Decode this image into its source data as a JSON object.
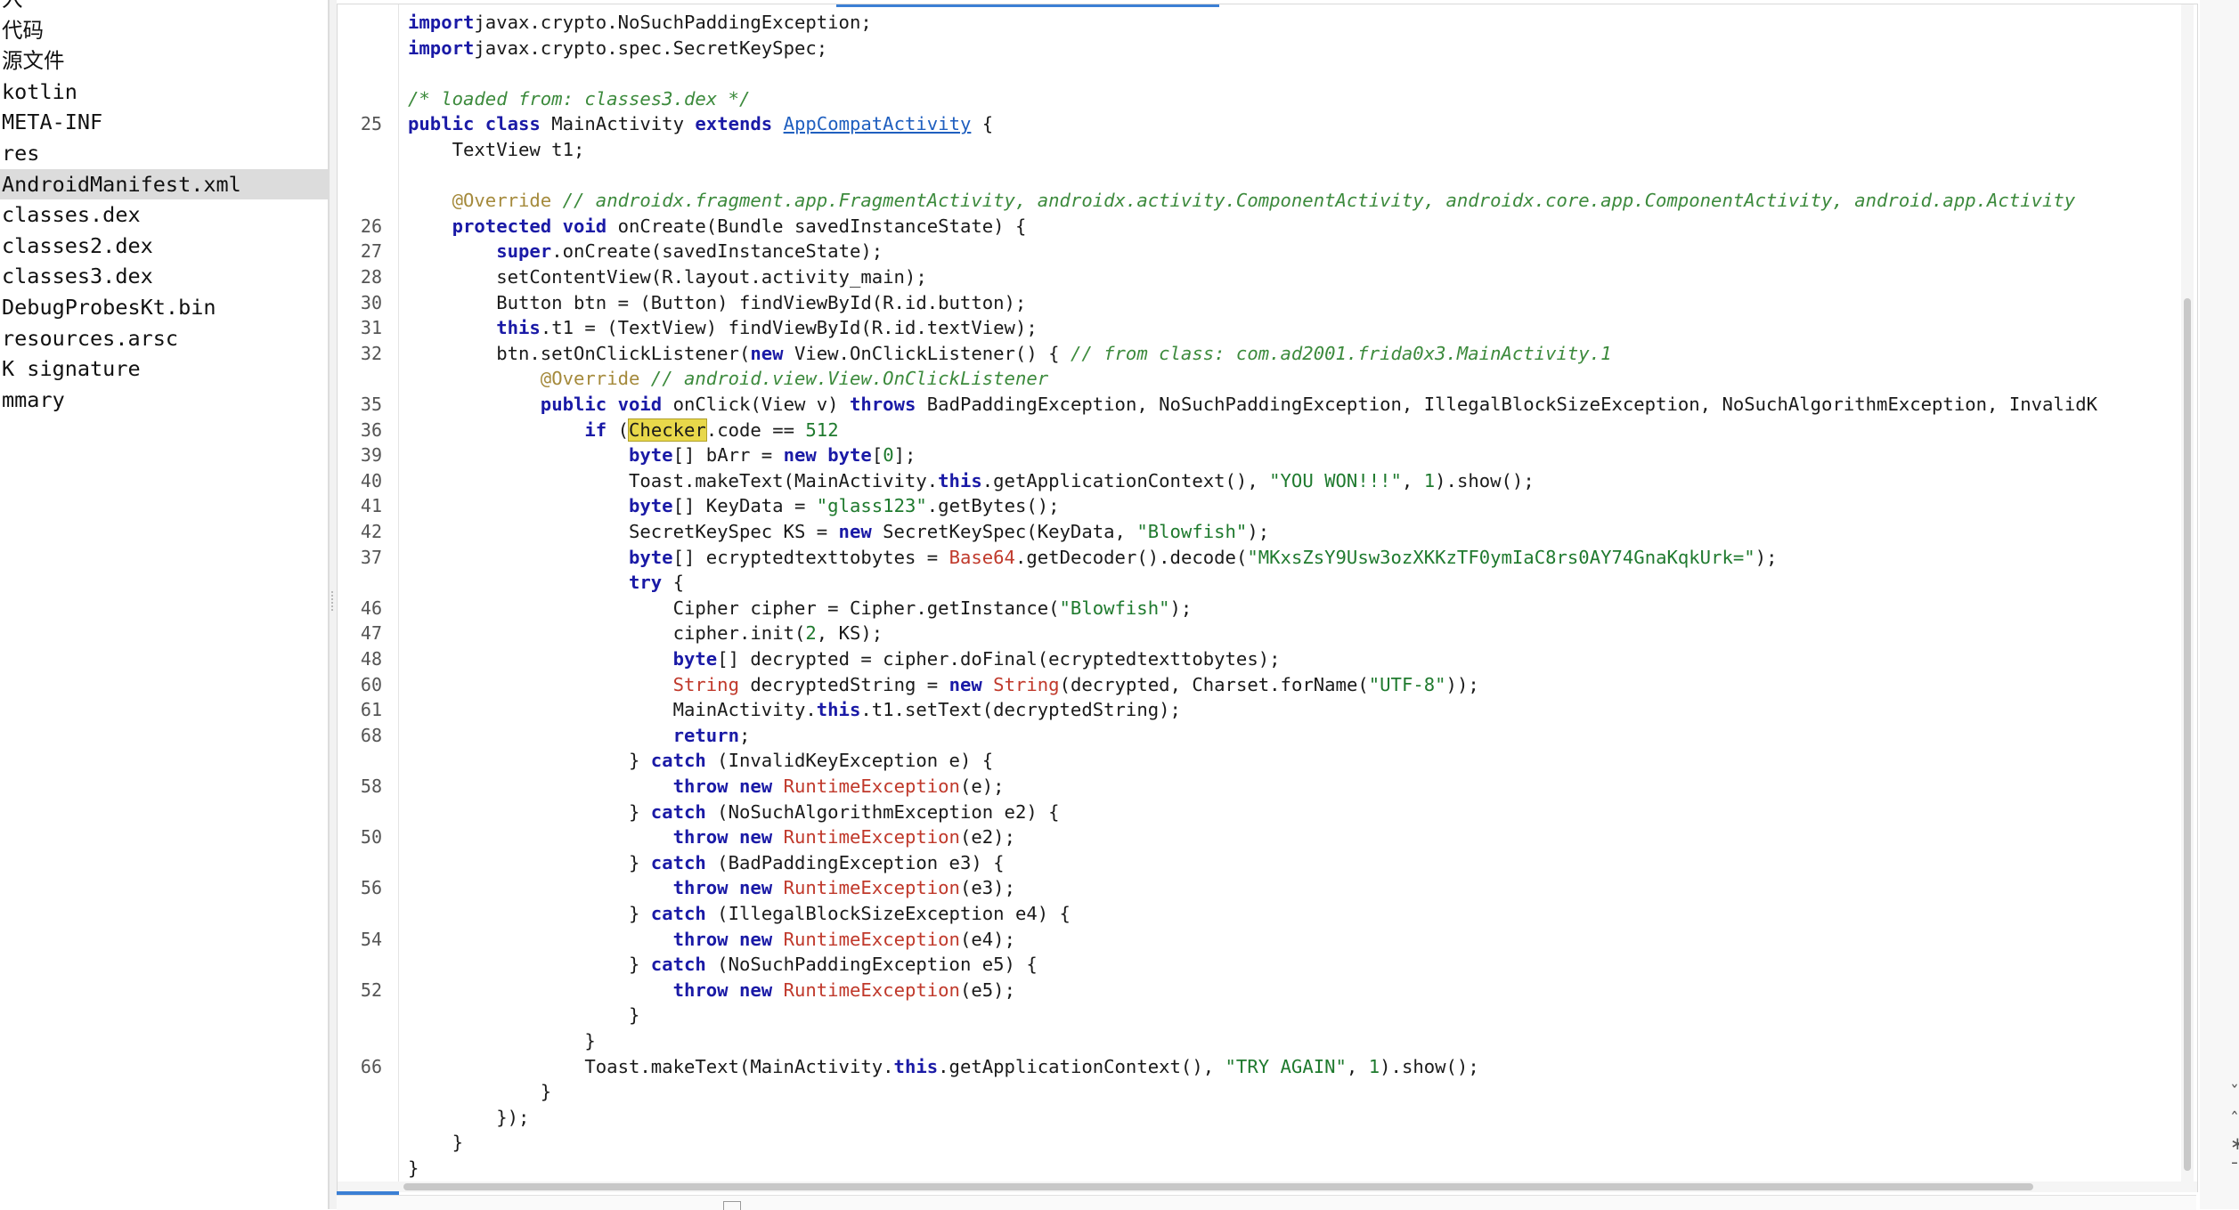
{
  "sidebar": {
    "items": [
      {
        "label": "入",
        "selected": false
      },
      {
        "label": "代码",
        "selected": false
      },
      {
        "label": "源文件",
        "selected": false
      },
      {
        "label": "kotlin",
        "selected": false
      },
      {
        "label": "META-INF",
        "selected": false
      },
      {
        "label": "res",
        "selected": false
      },
      {
        "label": "AndroidManifest.xml",
        "selected": true
      },
      {
        "label": "classes.dex",
        "selected": false
      },
      {
        "label": "classes2.dex",
        "selected": false
      },
      {
        "label": "classes3.dex",
        "selected": false
      },
      {
        "label": "DebugProbesKt.bin",
        "selected": false
      },
      {
        "label": "resources.arsc",
        "selected": false
      },
      {
        "label": "K signature",
        "selected": false
      },
      {
        "label": "mmary",
        "selected": false
      }
    ]
  },
  "editor": {
    "highlight_color": "#e8d84a",
    "lines": [
      {
        "n": "",
        "t": [
          [
            "kw",
            "import"
          ],
          [
            "",
            "javax.crypto.NoSuchPaddingException;"
          ]
        ]
      },
      {
        "n": "",
        "t": [
          [
            "kw",
            "import"
          ],
          [
            "",
            "javax.crypto.spec.SecretKeySpec;"
          ]
        ]
      },
      {
        "n": "",
        "t": []
      },
      {
        "n": "",
        "t": [
          [
            "cm",
            "/* loaded from: classes3.dex */"
          ]
        ]
      },
      {
        "n": "25",
        "t": [
          [
            "kw",
            "public class"
          ],
          [
            "",
            " MainActivity "
          ],
          [
            "kw",
            "extends"
          ],
          [
            "",
            " "
          ],
          [
            "lk",
            "AppCompatActivity"
          ],
          [
            "",
            " {"
          ]
        ]
      },
      {
        "n": "",
        "t": [
          [
            "",
            "    TextView t1;"
          ]
        ]
      },
      {
        "n": "",
        "t": []
      },
      {
        "n": "",
        "t": [
          [
            "",
            "    "
          ],
          [
            "an",
            "@Override"
          ],
          [
            "",
            " "
          ],
          [
            "cm",
            "// androidx.fragment.app.FragmentActivity, androidx.activity.ComponentActivity, androidx.core.app.ComponentActivity, android.app.Activity"
          ]
        ]
      },
      {
        "n": "26",
        "t": [
          [
            "",
            "    "
          ],
          [
            "kw",
            "protected void"
          ],
          [
            "",
            " onCreate(Bundle savedInstanceState) {"
          ]
        ]
      },
      {
        "n": "27",
        "t": [
          [
            "",
            "        "
          ],
          [
            "kw",
            "super"
          ],
          [
            "",
            ".onCreate(savedInstanceState);"
          ]
        ]
      },
      {
        "n": "28",
        "t": [
          [
            "",
            "        setContentView(R.layout.activity_main);"
          ]
        ]
      },
      {
        "n": "30",
        "t": [
          [
            "",
            "        Button btn = (Button) findViewById(R.id.button);"
          ]
        ]
      },
      {
        "n": "31",
        "t": [
          [
            "",
            "        "
          ],
          [
            "kw",
            "this"
          ],
          [
            "",
            ".t1 = (TextView) findViewById(R.id.textView);"
          ]
        ]
      },
      {
        "n": "32",
        "t": [
          [
            "",
            "        btn.setOnClickListener("
          ],
          [
            "kw",
            "new"
          ],
          [
            "",
            " View.OnClickListener() { "
          ],
          [
            "cm",
            "// from class: com.ad2001.frida0x3.MainActivity.1"
          ]
        ]
      },
      {
        "n": "",
        "t": [
          [
            "",
            "            "
          ],
          [
            "an",
            "@Override"
          ],
          [
            "",
            " "
          ],
          [
            "cm",
            "// android.view.View.OnClickListener"
          ]
        ]
      },
      {
        "n": "35",
        "t": [
          [
            "",
            "            "
          ],
          [
            "kw",
            "public void"
          ],
          [
            "",
            " onClick(View v) "
          ],
          [
            "kw",
            "throws"
          ],
          [
            "",
            " BadPaddingException, NoSuchPaddingException, IllegalBlockSizeException, NoSuchAlgorithmException, InvalidK"
          ]
        ]
      },
      {
        "n": "36",
        "t": [
          [
            "",
            "                "
          ],
          [
            "kw",
            "if"
          ],
          [
            "",
            " ("
          ],
          [
            "hl",
            "Checker"
          ],
          [
            "",
            ".code == "
          ],
          [
            "nm",
            "512"
          ],
          [
            ") {"
          ]
        ]
      },
      {
        "n": "39",
        "t": [
          [
            "",
            "                    "
          ],
          [
            "kw",
            "byte"
          ],
          [
            "",
            "[] bArr = "
          ],
          [
            "kw",
            "new"
          ],
          [
            "",
            " "
          ],
          [
            "kw",
            "byte"
          ],
          [
            "",
            "["
          ],
          [
            "nm",
            "0"
          ],
          [
            "",
            "];"
          ]
        ]
      },
      {
        "n": "40",
        "t": [
          [
            "",
            "                    Toast.makeText(MainActivity."
          ],
          [
            "kw",
            "this"
          ],
          [
            "",
            ".getApplicationContext(), "
          ],
          [
            "st",
            "\"YOU WON!!!\""
          ],
          [
            "",
            ", "
          ],
          [
            "nm",
            "1"
          ],
          [
            "",
            ").show();"
          ]
        ]
      },
      {
        "n": "41",
        "t": [
          [
            "",
            "                    "
          ],
          [
            "kw",
            "byte"
          ],
          [
            "",
            "[] KeyData = "
          ],
          [
            "st",
            "\"glass123\""
          ],
          [
            "",
            ".getBytes();"
          ]
        ]
      },
      {
        "n": "42",
        "t": [
          [
            "",
            "                    SecretKeySpec KS = "
          ],
          [
            "kw",
            "new"
          ],
          [
            "",
            " SecretKeySpec(KeyData, "
          ],
          [
            "st",
            "\"Blowfish\""
          ],
          [
            "",
            ");"
          ]
        ]
      },
      {
        "n": "37",
        "t": [
          [
            "",
            "                    "
          ],
          [
            "kw",
            "byte"
          ],
          [
            "",
            "[] ecryptedtexttobytes = "
          ],
          [
            "ty",
            "Base64"
          ],
          [
            "",
            ".getDecoder().decode("
          ],
          [
            "st",
            "\"MKxsZsY9Usw3ozXKKzTF0ymIaC8rs0AY74GnaKqkUrk=\""
          ],
          [
            "",
            ");"
          ]
        ]
      },
      {
        "n": "",
        "t": [
          [
            "",
            "                    "
          ],
          [
            "kw",
            "try"
          ],
          [
            "",
            " {"
          ]
        ]
      },
      {
        "n": "46",
        "t": [
          [
            "",
            "                        Cipher cipher = Cipher.getInstance("
          ],
          [
            "st",
            "\"Blowfish\""
          ],
          [
            "",
            ");"
          ]
        ]
      },
      {
        "n": "47",
        "t": [
          [
            "",
            "                        cipher.init("
          ],
          [
            "nm",
            "2"
          ],
          [
            "",
            ", KS);"
          ]
        ]
      },
      {
        "n": "48",
        "t": [
          [
            "",
            "                        "
          ],
          [
            "kw",
            "byte"
          ],
          [
            "",
            "[] decrypted = cipher.doFinal(ecryptedtexttobytes);"
          ]
        ]
      },
      {
        "n": "60",
        "t": [
          [
            "",
            "                        "
          ],
          [
            "ty",
            "String"
          ],
          [
            "",
            " decryptedString = "
          ],
          [
            "kw",
            "new"
          ],
          [
            "",
            " "
          ],
          [
            "ty",
            "String"
          ],
          [
            "",
            "(decrypted, Charset.forName("
          ],
          [
            "st",
            "\"UTF-8\""
          ],
          [
            "",
            "));"
          ]
        ]
      },
      {
        "n": "61",
        "t": [
          [
            "",
            "                        MainActivity."
          ],
          [
            "kw",
            "this"
          ],
          [
            "",
            ".t1.setText(decryptedString);"
          ]
        ]
      },
      {
        "n": "68",
        "t": [
          [
            "",
            "                        "
          ],
          [
            "kw",
            "return"
          ],
          [
            "",
            ";"
          ]
        ]
      },
      {
        "n": "",
        "t": [
          [
            "",
            "                    } "
          ],
          [
            "kw",
            "catch"
          ],
          [
            "",
            " (InvalidKeyException e) {"
          ]
        ]
      },
      {
        "n": "58",
        "t": [
          [
            "",
            "                        "
          ],
          [
            "kw",
            "throw new"
          ],
          [
            "",
            " "
          ],
          [
            "ty",
            "RuntimeException"
          ],
          [
            "",
            "(e);"
          ]
        ]
      },
      {
        "n": "",
        "t": [
          [
            "",
            "                    } "
          ],
          [
            "kw",
            "catch"
          ],
          [
            "",
            " (NoSuchAlgorithmException e2) {"
          ]
        ]
      },
      {
        "n": "50",
        "t": [
          [
            "",
            "                        "
          ],
          [
            "kw",
            "throw new"
          ],
          [
            "",
            " "
          ],
          [
            "ty",
            "RuntimeException"
          ],
          [
            "",
            "(e2);"
          ]
        ]
      },
      {
        "n": "",
        "t": [
          [
            "",
            "                    } "
          ],
          [
            "kw",
            "catch"
          ],
          [
            "",
            " (BadPaddingException e3) {"
          ]
        ]
      },
      {
        "n": "56",
        "t": [
          [
            "",
            "                        "
          ],
          [
            "kw",
            "throw new"
          ],
          [
            "",
            " "
          ],
          [
            "ty",
            "RuntimeException"
          ],
          [
            "",
            "(e3);"
          ]
        ]
      },
      {
        "n": "",
        "t": [
          [
            "",
            "                    } "
          ],
          [
            "kw",
            "catch"
          ],
          [
            "",
            " (IllegalBlockSizeException e4) {"
          ]
        ]
      },
      {
        "n": "54",
        "t": [
          [
            "",
            "                        "
          ],
          [
            "kw",
            "throw new"
          ],
          [
            "",
            " "
          ],
          [
            "ty",
            "RuntimeException"
          ],
          [
            "",
            "(e4);"
          ]
        ]
      },
      {
        "n": "",
        "t": [
          [
            "",
            "                    } "
          ],
          [
            "kw",
            "catch"
          ],
          [
            "",
            " (NoSuchPaddingException e5) {"
          ]
        ]
      },
      {
        "n": "52",
        "t": [
          [
            "",
            "                        "
          ],
          [
            "kw",
            "throw new"
          ],
          [
            "",
            " "
          ],
          [
            "ty",
            "RuntimeException"
          ],
          [
            "",
            "(e5);"
          ]
        ]
      },
      {
        "n": "",
        "t": [
          [
            "",
            "                    }"
          ]
        ]
      },
      {
        "n": "",
        "t": [
          [
            "",
            "                }"
          ]
        ]
      },
      {
        "n": "66",
        "t": [
          [
            "",
            "                Toast.makeText(MainActivity."
          ],
          [
            "kw",
            "this"
          ],
          [
            "",
            ".getApplicationContext(), "
          ],
          [
            "st",
            "\"TRY AGAIN\""
          ],
          [
            "",
            ", "
          ],
          [
            "nm",
            "1"
          ],
          [
            "",
            ").show();"
          ]
        ]
      },
      {
        "n": "",
        "t": [
          [
            "",
            "            }"
          ]
        ]
      },
      {
        "n": "",
        "t": [
          [
            "",
            "        });"
          ]
        ]
      },
      {
        "n": "",
        "t": [
          [
            "",
            "    }"
          ]
        ]
      },
      {
        "n": "",
        "t": [
          [
            "",
            "}"
          ]
        ]
      }
    ]
  },
  "right_panel": {
    "glyphs": [
      "ˇ",
      "ˆ",
      "∗",
      "ˉ"
    ]
  }
}
